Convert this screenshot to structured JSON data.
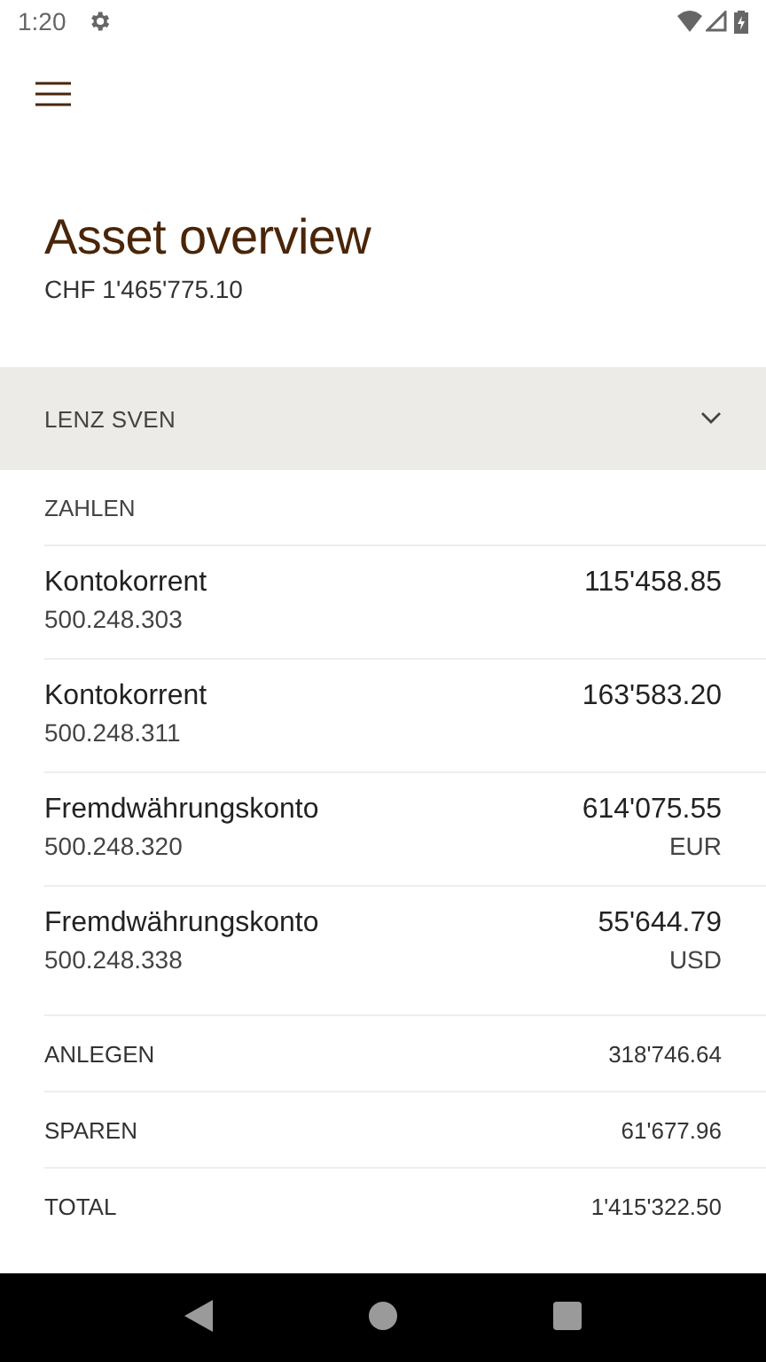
{
  "status_bar": {
    "time": "1:20"
  },
  "title": "Asset overview",
  "total": "CHF 1'465'775.10",
  "group": {
    "name": "LENZ SVEN",
    "expanded": true,
    "section": "ZAHLEN",
    "accounts": [
      {
        "name": "Kontokorrent",
        "number": "500.248.303",
        "amount": "115'458.85"
      },
      {
        "name": "Kontokorrent",
        "number": "500.248.311",
        "amount": "163'583.20"
      },
      {
        "name": "Fremdwährungskonto",
        "number": "500.248.320",
        "amount": "614'075.55",
        "currency": "EUR"
      },
      {
        "name": "Fremdwährungskonto",
        "number": "500.248.338",
        "amount": "55'644.79",
        "currency": "USD"
      }
    ],
    "summary": [
      {
        "label": "ANLEGEN",
        "amount": "318'746.64"
      },
      {
        "label": "SPAREN",
        "amount": "61'677.96"
      },
      {
        "label": "TOTAL",
        "amount": "1'415'322.50"
      }
    ]
  }
}
